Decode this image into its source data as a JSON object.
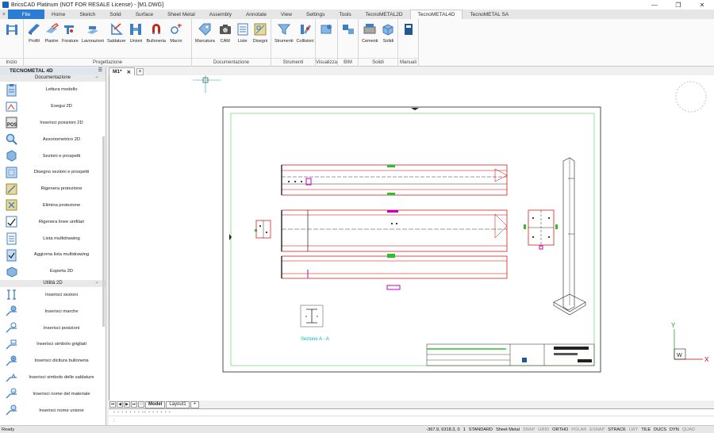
{
  "window": {
    "title": "BricsCAD Platinum (NOT FOR RESALE License) - [M1.DWG]"
  },
  "ribbon_tabs": [
    "File",
    "Home",
    "Sketch",
    "Solid",
    "Surface",
    "Sheet Metal",
    "Assembly",
    "Annotate",
    "View",
    "Settings",
    "Tools",
    "TecnoMETAL2D",
    "TecnoMETAL4D",
    "TecnoMETAL SA"
  ],
  "active_tab": "TecnoMETAL4D",
  "ribbon_groups": {
    "inizio": {
      "label": "Inizio"
    },
    "progettazione": {
      "label": "Progettazione",
      "buttons": [
        "Profili",
        "Piastre",
        "Forature",
        "Lavorazioni",
        "Saldature",
        "Unioni",
        "Bulloneria",
        "Macro"
      ]
    },
    "documentazione": {
      "label": "Documentazione",
      "buttons": [
        "Marcatura",
        "CAM",
        "Liste",
        "Disegni"
      ]
    },
    "strumenti": {
      "label": "Strumenti",
      "buttons": [
        "Strumenti",
        "Collisioni"
      ]
    },
    "visualizza": {
      "label": "Visualizza"
    },
    "bim": {
      "label": "BIM"
    },
    "solidi": {
      "label": "Solidi",
      "buttons": [
        "Cementi",
        "Solidi"
      ]
    },
    "manuali": {
      "label": "Manuali"
    }
  },
  "left_panel": {
    "title": "TECNOMETAL 4D",
    "section1": "Documentazione",
    "items1": [
      "Lettura modello",
      "Esegui 2D",
      "Inserisci posizioni 2D",
      "Assonometrico 2D",
      "Sezioni e prospetti",
      "Disegno sezioni e prospetti",
      "Rigenera proiezione",
      "Elimina proiezione",
      "Rigenera linee unifilari",
      "Lista multidrawing",
      "Aggiorna lista multidrawing",
      "Esporta 2D"
    ],
    "section2": "Utilità 2D",
    "items2": [
      "Inserisci sezioni",
      "Inserisci marche",
      "Inserisci posizioni",
      "Inserisci simbolo grigliati",
      "Inserisci dicitura bulloneria",
      "Inserisci simbolo delle saldature",
      "Inserisci nome del materiale",
      "Inserisci nome unione"
    ]
  },
  "doc_tab": {
    "label": "M1*",
    "close": "✕",
    "plus": "+"
  },
  "drawing": {
    "section_label": "Sezione  A - A",
    "ucs_y": "Y",
    "ucs_x": "X",
    "ucs_w": "W"
  },
  "layout_tabs": {
    "model": "Model",
    "layout1": "Layout1",
    "plus": "+"
  },
  "command_line": {
    "history": "▪ ▪ ▪ ▪ ▪ ▪ ▪  ▪▪  ▪ ▪ ▪  ▪ ▪ ▪",
    "prompt": ":"
  },
  "status": {
    "ready": "Ready",
    "coords": "-367.9, 6318.3, 0",
    "scale": "1",
    "style": "STANDARD",
    "workspace": "Sheet Metal",
    "toggles": [
      {
        "label": "SNAP",
        "on": false
      },
      {
        "label": "GRID",
        "on": false
      },
      {
        "label": "ORTHO",
        "on": true
      },
      {
        "label": "POLAR",
        "on": false
      },
      {
        "label": "ESNAP",
        "on": false
      },
      {
        "label": "STRACK",
        "on": true
      },
      {
        "label": "LWT",
        "on": false
      },
      {
        "label": "TILE",
        "on": true
      },
      {
        "label": "DUCS",
        "on": true
      },
      {
        "label": "DYN",
        "on": true
      },
      {
        "label": "QUAD",
        "on": false
      }
    ]
  },
  "colors": {
    "accent": "#2b7cd3",
    "drawing_red": "#cc0000",
    "drawing_green": "#27c227",
    "drawing_cyan": "#00b8b8",
    "drawing_magenta": "#c000c0"
  }
}
